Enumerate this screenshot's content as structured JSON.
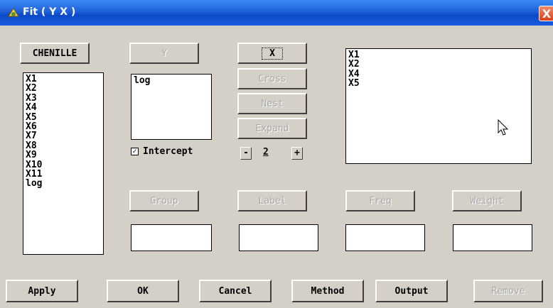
{
  "window": {
    "title": "Fit ( Y X )",
    "close_label": "X"
  },
  "buttons": {
    "dataset": "CHENILLE",
    "y": "Y",
    "x": "X",
    "cross": "Cross",
    "nest": "Nest",
    "expand": "Expand",
    "group": "Group",
    "label": "Label",
    "freq": "Freq",
    "weight": "Weight"
  },
  "variables_list": [
    "X1",
    "X2",
    "X3",
    "X4",
    "X5",
    "X6",
    "X7",
    "X8",
    "X9",
    "X10",
    "X11",
    "log"
  ],
  "y_list": [
    "log"
  ],
  "x_list": [
    "X1",
    "X2",
    "X4",
    "X5"
  ],
  "intercept": {
    "label": "Intercept",
    "checked": true,
    "mark": "✓"
  },
  "degree": {
    "minus": "-",
    "value": "2",
    "plus": "+"
  },
  "footer": {
    "apply": "Apply",
    "ok": "OK",
    "cancel": "Cancel",
    "method": "Method",
    "output": "Output",
    "remove": "Remove"
  },
  "icons": [
    "sas-app-icon",
    "close-icon",
    "mouse-cursor-icon"
  ]
}
